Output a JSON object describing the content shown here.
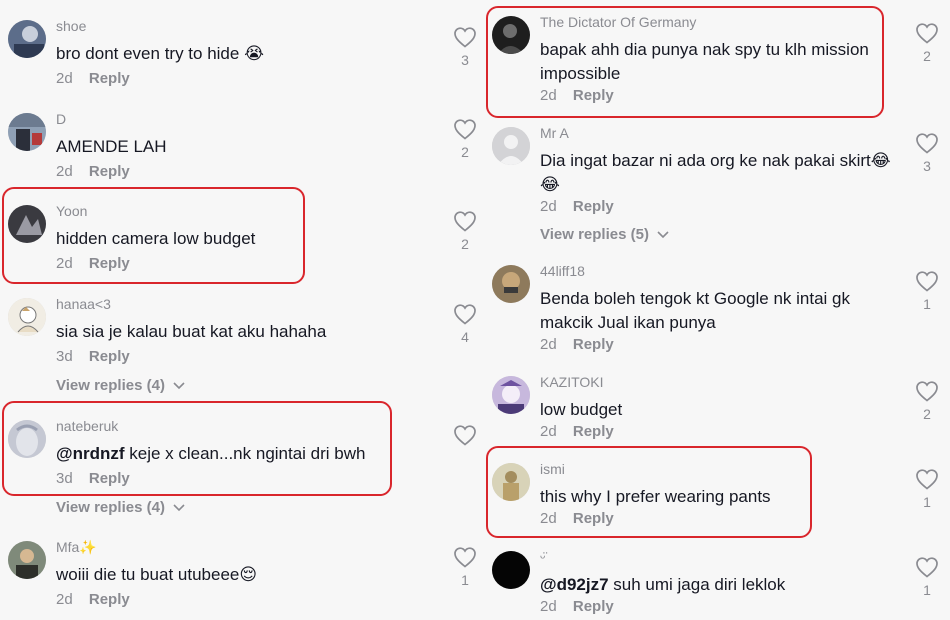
{
  "ui": {
    "reply_label": "Reply",
    "highlight_color": "#d9262c",
    "text_color": "#161823",
    "muted_color": "#8a8b91"
  },
  "left": [
    {
      "user": "shoe",
      "text": "bro dont even try to hide 😭",
      "date": "2d",
      "likes": "3"
    },
    {
      "user": "D",
      "text": "AMENDE LAH",
      "date": "2d",
      "likes": "2"
    },
    {
      "user": "Yoon",
      "text": "hidden camera low budget",
      "date": "2d",
      "likes": "2"
    },
    {
      "user": "hanaa<3",
      "text": "sia sia je kalau buat kat aku hahaha",
      "date": "3d",
      "likes": "4",
      "view_replies": "View replies (4)"
    },
    {
      "user": "nateberuk",
      "mention": "@nrdnzf",
      "text": " keje x clean...nk ngintai dri bwh",
      "date": "3d",
      "likes": "",
      "view_replies": "View replies (4)"
    },
    {
      "user": "Mfa✨",
      "text": "woiii die tu buat utubeee😌",
      "date": "2d",
      "likes": "1"
    }
  ],
  "right": [
    {
      "user": "The Dictator Of Germany",
      "text_lines": [
        "bapak ahh dia punya nak spy tu klh mission",
        "impossible"
      ],
      "date": "2d",
      "likes": "2"
    },
    {
      "user": "Mr A",
      "text_lines": [
        "Dia ingat bazar ni ada org ke nak pakai skirt😂",
        "😂"
      ],
      "date": "2d",
      "likes": "3",
      "view_replies": "View replies (5)"
    },
    {
      "user": "44liff18",
      "text_lines": [
        "Benda boleh tengok kt Google nk intai gk",
        "makcik Jual ikan punya"
      ],
      "date": "2d",
      "likes": "1"
    },
    {
      "user": "KAZITOKI",
      "text_lines": [
        "low budget"
      ],
      "date": "2d",
      "likes": "2"
    },
    {
      "user": "ismi",
      "text_lines": [
        "this why I prefer wearing pants"
      ],
      "date": "2d",
      "likes": "1"
    },
    {
      "user": "ᵕ̈",
      "mention": "@d92jz7",
      "text_lines": [
        " suh umi jaga diri leklok"
      ],
      "date": "2d",
      "likes": "1"
    }
  ]
}
